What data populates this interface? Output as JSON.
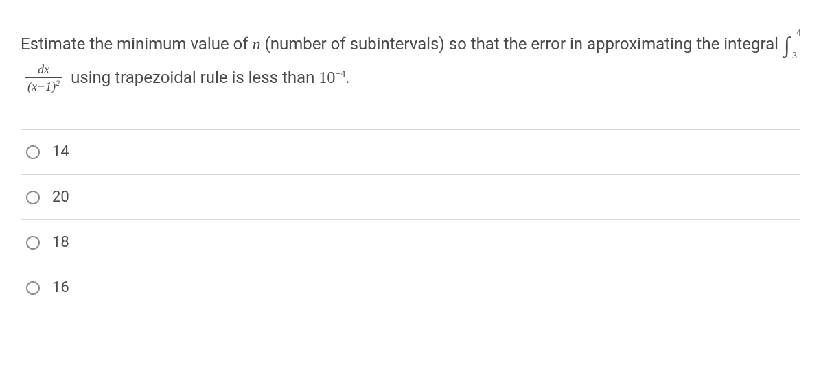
{
  "question": {
    "text_before": "Estimate the minimum value of ",
    "variable_n": "n",
    "text_mid1": " (number of subintervals) so that the error in approximating the integral ",
    "integral_lower": "3",
    "integral_upper": "4",
    "fraction_num": "dx",
    "fraction_den_inner": "x−1",
    "fraction_den_power": "2",
    "text_mid2": " using trapezoidal rule is less than ",
    "ten_base": "10",
    "ten_exp": "−4",
    "text_end": "."
  },
  "options": [
    {
      "label": "14"
    },
    {
      "label": "20"
    },
    {
      "label": "18"
    },
    {
      "label": "16"
    }
  ]
}
